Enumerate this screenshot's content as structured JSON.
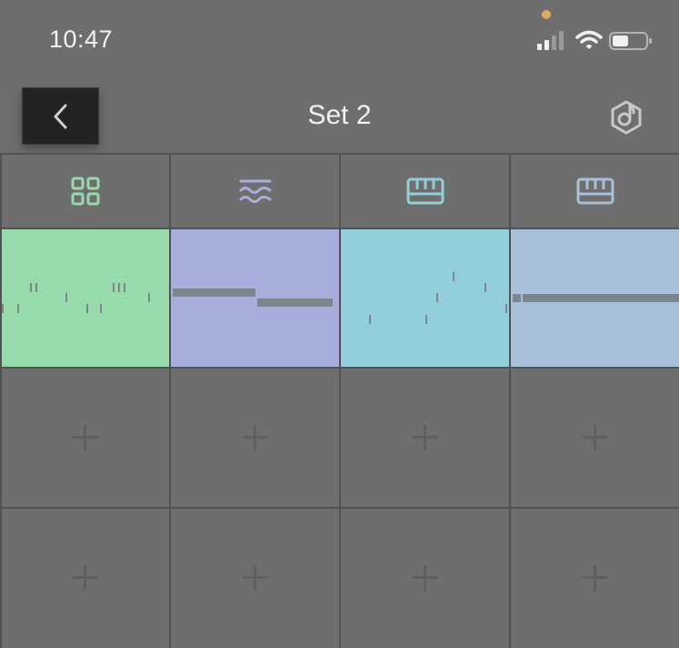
{
  "status_bar": {
    "time": "10:47",
    "signal_icon": "signal-bars-icon",
    "wifi_icon": "wifi-icon",
    "battery_icon": "battery-icon",
    "privacy_dot_color": "#e0a85e"
  },
  "nav": {
    "back_icon": "chevron-left-icon",
    "title": "Set 2",
    "link_icon": "ableton-link-icon"
  },
  "colors": {
    "background": "#6e6e6e",
    "grid_lines": "#525252",
    "empty_plus": "#5f5f5f",
    "note_marks": "#7d858d"
  },
  "tracks": [
    {
      "icon": "drum-grid-icon",
      "color": "#97dbac",
      "icon_color": "#97dbac"
    },
    {
      "icon": "wave-synth-icon",
      "color": "#a8aedc",
      "icon_color": "#a8aedc"
    },
    {
      "icon": "keyboard-icon",
      "color": "#93cfdb",
      "icon_color": "#93cfdb"
    },
    {
      "icon": "keyboard-icon",
      "color": "#a9c0da",
      "icon_color": "#a9c0da"
    }
  ],
  "scenes": [
    {
      "clips": [
        "filled",
        "filled",
        "filled",
        "filled"
      ]
    },
    {
      "clips": [
        "empty",
        "empty",
        "empty",
        "empty"
      ]
    },
    {
      "clips": [
        "empty",
        "empty",
        "empty",
        "empty"
      ]
    }
  ]
}
